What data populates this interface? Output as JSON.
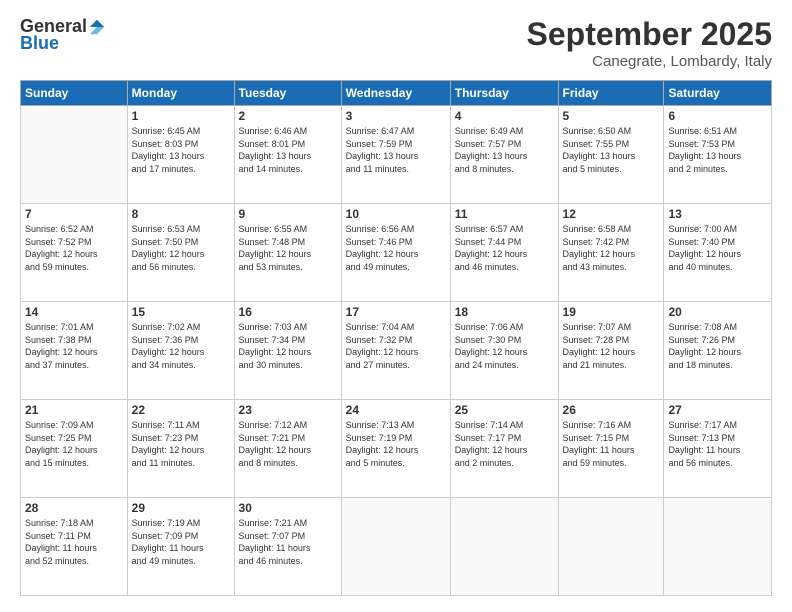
{
  "logo": {
    "general": "General",
    "blue": "Blue"
  },
  "header": {
    "month": "September 2025",
    "location": "Canegrate, Lombardy, Italy"
  },
  "days_of_week": [
    "Sunday",
    "Monday",
    "Tuesday",
    "Wednesday",
    "Thursday",
    "Friday",
    "Saturday"
  ],
  "weeks": [
    [
      {
        "day": "",
        "info": ""
      },
      {
        "day": "1",
        "info": "Sunrise: 6:45 AM\nSunset: 8:03 PM\nDaylight: 13 hours\nand 17 minutes."
      },
      {
        "day": "2",
        "info": "Sunrise: 6:46 AM\nSunset: 8:01 PM\nDaylight: 13 hours\nand 14 minutes."
      },
      {
        "day": "3",
        "info": "Sunrise: 6:47 AM\nSunset: 7:59 PM\nDaylight: 13 hours\nand 11 minutes."
      },
      {
        "day": "4",
        "info": "Sunrise: 6:49 AM\nSunset: 7:57 PM\nDaylight: 13 hours\nand 8 minutes."
      },
      {
        "day": "5",
        "info": "Sunrise: 6:50 AM\nSunset: 7:55 PM\nDaylight: 13 hours\nand 5 minutes."
      },
      {
        "day": "6",
        "info": "Sunrise: 6:51 AM\nSunset: 7:53 PM\nDaylight: 13 hours\nand 2 minutes."
      }
    ],
    [
      {
        "day": "7",
        "info": "Sunrise: 6:52 AM\nSunset: 7:52 PM\nDaylight: 12 hours\nand 59 minutes."
      },
      {
        "day": "8",
        "info": "Sunrise: 6:53 AM\nSunset: 7:50 PM\nDaylight: 12 hours\nand 56 minutes."
      },
      {
        "day": "9",
        "info": "Sunrise: 6:55 AM\nSunset: 7:48 PM\nDaylight: 12 hours\nand 53 minutes."
      },
      {
        "day": "10",
        "info": "Sunrise: 6:56 AM\nSunset: 7:46 PM\nDaylight: 12 hours\nand 49 minutes."
      },
      {
        "day": "11",
        "info": "Sunrise: 6:57 AM\nSunset: 7:44 PM\nDaylight: 12 hours\nand 46 minutes."
      },
      {
        "day": "12",
        "info": "Sunrise: 6:58 AM\nSunset: 7:42 PM\nDaylight: 12 hours\nand 43 minutes."
      },
      {
        "day": "13",
        "info": "Sunrise: 7:00 AM\nSunset: 7:40 PM\nDaylight: 12 hours\nand 40 minutes."
      }
    ],
    [
      {
        "day": "14",
        "info": "Sunrise: 7:01 AM\nSunset: 7:38 PM\nDaylight: 12 hours\nand 37 minutes."
      },
      {
        "day": "15",
        "info": "Sunrise: 7:02 AM\nSunset: 7:36 PM\nDaylight: 12 hours\nand 34 minutes."
      },
      {
        "day": "16",
        "info": "Sunrise: 7:03 AM\nSunset: 7:34 PM\nDaylight: 12 hours\nand 30 minutes."
      },
      {
        "day": "17",
        "info": "Sunrise: 7:04 AM\nSunset: 7:32 PM\nDaylight: 12 hours\nand 27 minutes."
      },
      {
        "day": "18",
        "info": "Sunrise: 7:06 AM\nSunset: 7:30 PM\nDaylight: 12 hours\nand 24 minutes."
      },
      {
        "day": "19",
        "info": "Sunrise: 7:07 AM\nSunset: 7:28 PM\nDaylight: 12 hours\nand 21 minutes."
      },
      {
        "day": "20",
        "info": "Sunrise: 7:08 AM\nSunset: 7:26 PM\nDaylight: 12 hours\nand 18 minutes."
      }
    ],
    [
      {
        "day": "21",
        "info": "Sunrise: 7:09 AM\nSunset: 7:25 PM\nDaylight: 12 hours\nand 15 minutes."
      },
      {
        "day": "22",
        "info": "Sunrise: 7:11 AM\nSunset: 7:23 PM\nDaylight: 12 hours\nand 11 minutes."
      },
      {
        "day": "23",
        "info": "Sunrise: 7:12 AM\nSunset: 7:21 PM\nDaylight: 12 hours\nand 8 minutes."
      },
      {
        "day": "24",
        "info": "Sunrise: 7:13 AM\nSunset: 7:19 PM\nDaylight: 12 hours\nand 5 minutes."
      },
      {
        "day": "25",
        "info": "Sunrise: 7:14 AM\nSunset: 7:17 PM\nDaylight: 12 hours\nand 2 minutes."
      },
      {
        "day": "26",
        "info": "Sunrise: 7:16 AM\nSunset: 7:15 PM\nDaylight: 11 hours\nand 59 minutes."
      },
      {
        "day": "27",
        "info": "Sunrise: 7:17 AM\nSunset: 7:13 PM\nDaylight: 11 hours\nand 56 minutes."
      }
    ],
    [
      {
        "day": "28",
        "info": "Sunrise: 7:18 AM\nSunset: 7:11 PM\nDaylight: 11 hours\nand 52 minutes."
      },
      {
        "day": "29",
        "info": "Sunrise: 7:19 AM\nSunset: 7:09 PM\nDaylight: 11 hours\nand 49 minutes."
      },
      {
        "day": "30",
        "info": "Sunrise: 7:21 AM\nSunset: 7:07 PM\nDaylight: 11 hours\nand 46 minutes."
      },
      {
        "day": "",
        "info": ""
      },
      {
        "day": "",
        "info": ""
      },
      {
        "day": "",
        "info": ""
      },
      {
        "day": "",
        "info": ""
      }
    ]
  ]
}
